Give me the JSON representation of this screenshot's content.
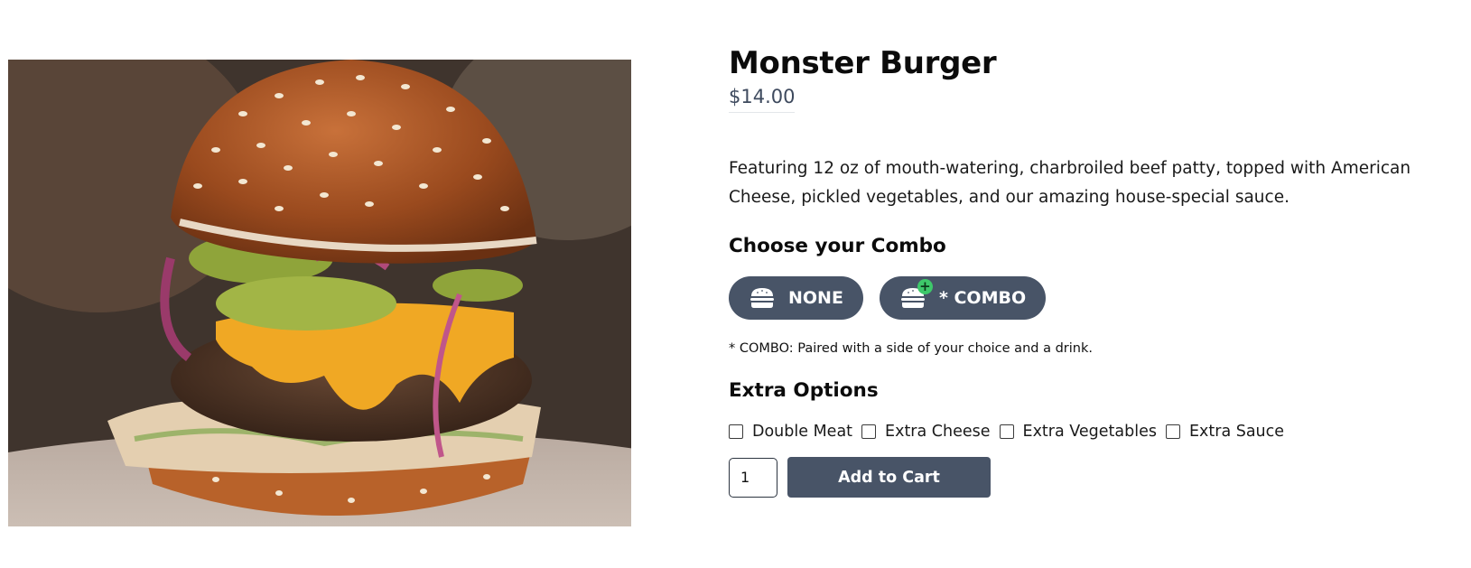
{
  "product": {
    "image_icon": "burger-photo",
    "title": "Monster Burger",
    "price": "$14.00",
    "description": "Featuring 12 oz of mouth-watering, charbroiled beef patty, topped with American Cheese, pickled vegetables, and our amazing house-special sauce."
  },
  "combo": {
    "heading": "Choose your Combo",
    "options": [
      {
        "label": "NONE",
        "icon": "burger-icon"
      },
      {
        "label": "* COMBO",
        "icon": "burger-plus-icon",
        "badge": "+"
      }
    ],
    "note": "* COMBO: Paired with a side of your choice and a drink."
  },
  "extras": {
    "heading": "Extra Options",
    "options": [
      {
        "label": "Double Meat",
        "checked": false
      },
      {
        "label": "Extra Cheese",
        "checked": false
      },
      {
        "label": "Extra Vegetables",
        "checked": false
      },
      {
        "label": "Extra Sauce",
        "checked": false
      }
    ]
  },
  "cart": {
    "quantity": "1",
    "add_label": "Add to Cart"
  },
  "colors": {
    "button_bg": "#485467",
    "price_text": "#3e4a5e",
    "badge_green": "#3ec86a"
  }
}
